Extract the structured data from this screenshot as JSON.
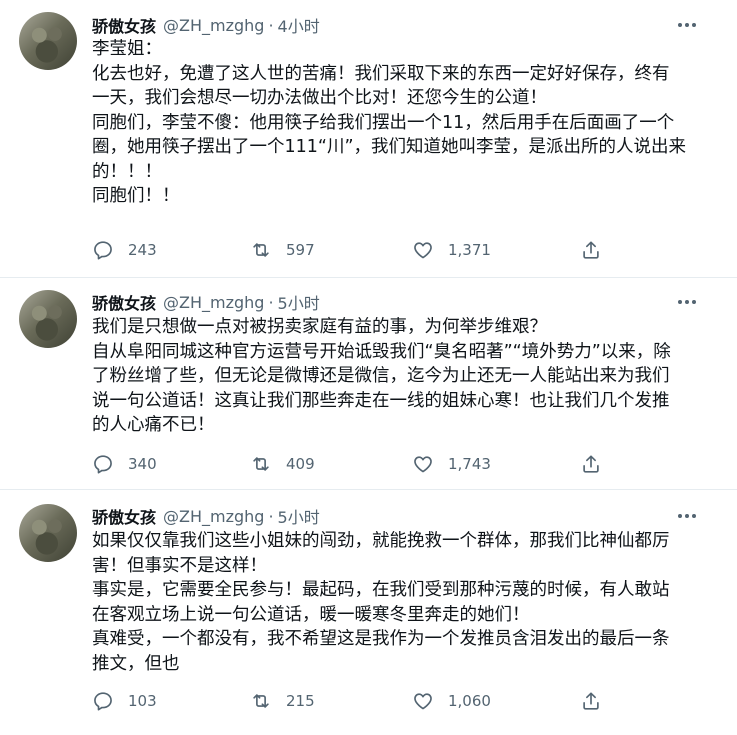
{
  "tweets": [
    {
      "name": "骄傲女孩",
      "handle": "@ZH_mzghg",
      "separator": "·",
      "time": "4小时",
      "lines": [
        "李莹姐：",
        "化去也好，免遭了这人世的苦痛！我们采取下来的东西一定好好保存，终有",
        "一天，我们会想尽一切办法做出个比对！还您今生的公道！",
        "同胞们，李莹不傻：他用筷子给我们摆出一个11，然后用手在后面画了一个",
        "圈，她用筷子摆出了一个111“川”，我们知道她叫李莹，是派出所的人说出来",
        "的！！！",
        "同胞们！！"
      ],
      "replies": "243",
      "retweets": "597",
      "likes": "1,371"
    },
    {
      "name": "骄傲女孩",
      "handle": "@ZH_mzghg",
      "separator": "·",
      "time": "5小时",
      "lines": [
        "我们是只想做一点对被拐卖家庭有益的事，为何举步维艰？",
        "自从阜阳同城这种官方运营号开始诋毁我们“臭名昭著”“境外势力”以来，除",
        "了粉丝增了些，但无论是微博还是微信，迄今为止还无一人能站出来为我们",
        "说一句公道话！这真让我们那些奔走在一线的姐妹心寒！也让我们几个发推",
        "的人心痛不已！"
      ],
      "replies": "340",
      "retweets": "409",
      "likes": "1,743"
    },
    {
      "name": "骄傲女孩",
      "handle": "@ZH_mzghg",
      "separator": "·",
      "time": "5小时",
      "lines": [
        "如果仅仅靠我们这些小姐妹的闯劲，就能挽救一个群体，那我们比神仙都厉",
        "害！但事实不是这样！",
        "事实是，它需要全民参与！最起码，在我们受到那种污蔑的时候，有人敢站",
        "在客观立场上说一句公道话，暖一暖寒冬里奔走的她们！",
        "真难受，一个都没有，我不希望这是我作为一个发推员含泪发出的最后一条",
        "推文，但也"
      ],
      "replies": "103",
      "retweets": "215",
      "likes": "1,060"
    }
  ],
  "colors": {
    "text": "#0f1419",
    "secondary": "#536471",
    "divider": "#e6ecf0"
  },
  "icons": [
    "avatar",
    "more-icon",
    "reply-icon",
    "retweet-icon",
    "like-icon",
    "share-icon"
  ]
}
